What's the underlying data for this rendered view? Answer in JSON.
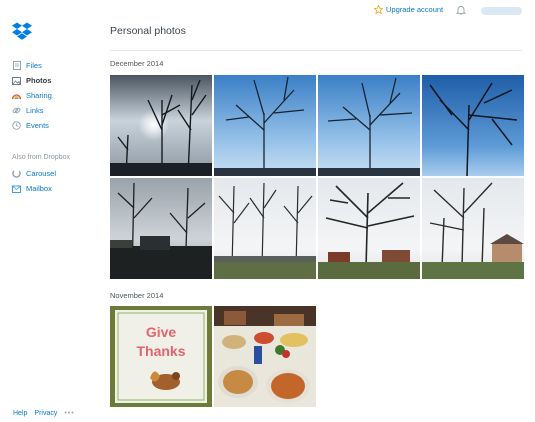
{
  "sidebar": {
    "nav": [
      {
        "label": "Files",
        "icon": "files-icon",
        "active": false
      },
      {
        "label": "Photos",
        "icon": "photos-icon",
        "active": true
      },
      {
        "label": "Sharing",
        "icon": "sharing-icon",
        "active": false
      },
      {
        "label": "Links",
        "icon": "links-icon",
        "active": false
      },
      {
        "label": "Events",
        "icon": "events-icon",
        "active": false
      }
    ],
    "also_heading": "Also from Dropbox",
    "also_items": [
      {
        "label": "Carousel",
        "icon": "carousel-icon"
      },
      {
        "label": "Mailbox",
        "icon": "mailbox-icon"
      }
    ],
    "footer": {
      "help": "Help",
      "privacy": "Privacy",
      "more": "•••"
    }
  },
  "header": {
    "upgrade_label": "Upgrade account",
    "notification_icon": "bell-icon",
    "user_menu_icon": "user-menu"
  },
  "main": {
    "title": "Personal photos",
    "sections": [
      {
        "label": "December 2014",
        "photos": [
          "bare trees silhouette against sun",
          "bare tree against blue sky",
          "bare tree against blue sky",
          "bare tree against deep blue sky",
          "trees over dark yard with fence",
          "bare trees and lawn",
          "large bare tree near houses",
          "bare trees with house"
        ]
      },
      {
        "label": "November 2014",
        "photos": [
          "Give Thanks placemat with turkey",
          "thanksgiving dinner table with pies"
        ]
      }
    ],
    "give_thanks_text": [
      "Give",
      "Thanks"
    ]
  },
  "colors": {
    "accent": "#0a7ac8",
    "brand": "#007ee5",
    "upgrade_star": "#f2a71b",
    "text": "#3d464d",
    "muted": "#8f979c"
  }
}
